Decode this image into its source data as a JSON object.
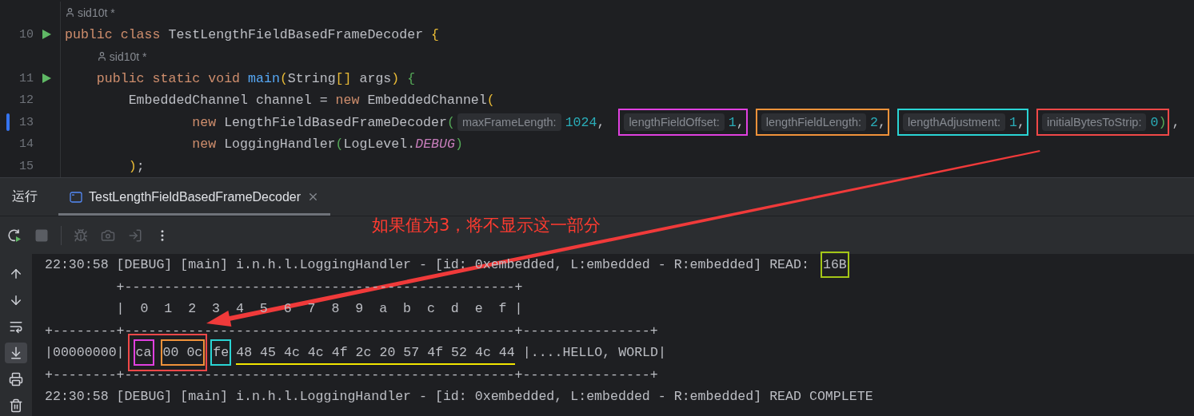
{
  "editor": {
    "lines": [
      {
        "number": "10",
        "runnable": true,
        "modified": false,
        "author": "sid10t *",
        "tokens": [
          {
            "kind": "keyword",
            "text": "public class "
          },
          {
            "kind": "text",
            "text": "TestLengthFieldBasedFrameDecoder "
          },
          {
            "kind": "bracket",
            "text": "{",
            "color": "#e8ba36"
          }
        ]
      },
      {
        "number": "11",
        "runnable": true,
        "modified": false,
        "author": "sid10t *",
        "tokens": [
          {
            "kind": "keyword",
            "text": "    public static void "
          },
          {
            "kind": "method",
            "text": "main"
          },
          {
            "kind": "bracket",
            "text": "(",
            "color": "#e8ba36"
          },
          {
            "kind": "text",
            "text": "String"
          },
          {
            "kind": "bracket",
            "text": "[]",
            "color": "#e8ba36"
          },
          {
            "kind": "text",
            "text": " args"
          },
          {
            "kind": "bracket",
            "text": ")",
            "color": "#e8ba36"
          },
          {
            "kind": "bracket",
            "text": " {",
            "color": "#54a857"
          }
        ]
      },
      {
        "number": "12",
        "runnable": false,
        "modified": false,
        "tokens": [
          {
            "kind": "text",
            "text": "        EmbeddedChannel channel = "
          },
          {
            "kind": "keyword",
            "text": "new"
          },
          {
            "kind": "text",
            "text": " EmbeddedChannel"
          },
          {
            "kind": "bracket",
            "text": "(",
            "color": "#e8ba36"
          }
        ]
      },
      {
        "number": "13",
        "runnable": false,
        "modified": true,
        "tokens": [
          {
            "kind": "keyword",
            "text": "                new"
          },
          {
            "kind": "text",
            "text": " LengthFieldBasedFrameDecoder"
          },
          {
            "kind": "bracket",
            "text": "(",
            "color": "#54a857"
          },
          {
            "kind": "hint",
            "text": "maxFrameLength:"
          },
          {
            "kind": "number",
            "text": "1024"
          },
          {
            "kind": "text",
            "text": ", "
          },
          {
            "kind": "boxed",
            "color": "#e040e0",
            "tokens": [
              {
                "kind": "hint",
                "text": "lengthFieldOffset:"
              },
              {
                "kind": "number",
                "text": "1"
              },
              {
                "kind": "text",
                "text": ","
              }
            ]
          },
          {
            "kind": "boxed",
            "color": "#f0923a",
            "tokens": [
              {
                "kind": "hint",
                "text": "lengthFieldLength:"
              },
              {
                "kind": "number",
                "text": "2"
              },
              {
                "kind": "text",
                "text": ","
              }
            ]
          },
          {
            "kind": "boxed",
            "color": "#2ad4d4",
            "tokens": [
              {
                "kind": "hint",
                "text": "lengthAdjustment:"
              },
              {
                "kind": "number",
                "text": "1"
              },
              {
                "kind": "text",
                "text": ","
              }
            ]
          },
          {
            "kind": "boxed",
            "color": "#f04848",
            "tokens": [
              {
                "kind": "hint",
                "text": "initialBytesToStrip:"
              },
              {
                "kind": "number",
                "text": "0"
              },
              {
                "kind": "bracket",
                "text": ")",
                "color": "#54a857"
              }
            ]
          },
          {
            "kind": "text",
            "text": ","
          }
        ]
      },
      {
        "number": "14",
        "runnable": false,
        "modified": false,
        "tokens": [
          {
            "kind": "keyword",
            "text": "                new"
          },
          {
            "kind": "text",
            "text": " LoggingHandler"
          },
          {
            "kind": "bracket",
            "text": "(",
            "color": "#54a857"
          },
          {
            "kind": "text",
            "text": "LogLevel."
          },
          {
            "kind": "constant",
            "text": "DEBUG"
          },
          {
            "kind": "bracket",
            "text": ")",
            "color": "#54a857"
          }
        ]
      },
      {
        "number": "15",
        "runnable": false,
        "modified": false,
        "tokens": [
          {
            "kind": "bracket",
            "text": "        )",
            "color": "#e8ba36"
          },
          {
            "kind": "text",
            "text": ";"
          }
        ]
      }
    ]
  },
  "run_panel": {
    "title": "运行",
    "tabs": [
      {
        "label": "TestLengthFieldBasedFrameDecoder",
        "selected": true
      }
    ],
    "toolbar": [
      {
        "disabled": false
      },
      {
        "disabled": true
      },
      {
        "disabled": true
      },
      {
        "disabled": true
      },
      {
        "disabled": true
      },
      {
        "disabled": false
      }
    ],
    "side_toolbar": [
      {
        "selected": false
      },
      {
        "selected": false
      },
      {
        "selected": false
      },
      {
        "selected": true
      },
      {
        "selected": false
      },
      {
        "selected": false
      }
    ],
    "console": [
      [
        {
          "kind": "plain",
          "text": "22:30:58 [DEBUG] [main] i.n.h.l.LoggingHandler - [id: 0xembedded, L:embedded - R:embedded] READ: "
        },
        {
          "kind": "box",
          "color": "#a4c617",
          "text": "16B"
        }
      ],
      [
        {
          "kind": "plain",
          "text": "         +-------------------------------------------------+"
        }
      ],
      [
        {
          "kind": "plain",
          "text": "         |  0  1  2  3  4  5  6  7  8  9  a  b  c  d  e  f |"
        }
      ],
      [
        {
          "kind": "plain",
          "text": "+--------+-------------------------------------------------+----------------+"
        }
      ],
      [
        {
          "kind": "plain",
          "text": "|00000000|"
        },
        {
          "kind": "box",
          "color": "#f04848",
          "children": [
            {
              "kind": "box",
              "color": "#e040e0",
              "text": "ca"
            },
            {
              "kind": "box",
              "color": "#f0923a",
              "text": "00 0c"
            }
          ]
        },
        {
          "kind": "box",
          "color": "#2ad4d4",
          "text": "fe"
        },
        {
          "kind": "underline",
          "color": "#f2e600",
          "text": "48 45 4c 4c 4f 2c 20 57 4f 52 4c 44"
        },
        {
          "kind": "plain",
          "text": " |....HELLO, WORLD|"
        }
      ],
      [
        {
          "kind": "plain",
          "text": "+--------+-------------------------------------------------+----------------+"
        }
      ],
      [
        {
          "kind": "plain",
          "text": "22:30:58 [DEBUG] [main] i.n.h.l.LoggingHandler - [id: 0xembedded, L:embedded - R:embedded] READ COMPLETE"
        }
      ]
    ]
  },
  "annotation": {
    "note": "如果值为3，将不显示这一部分"
  }
}
